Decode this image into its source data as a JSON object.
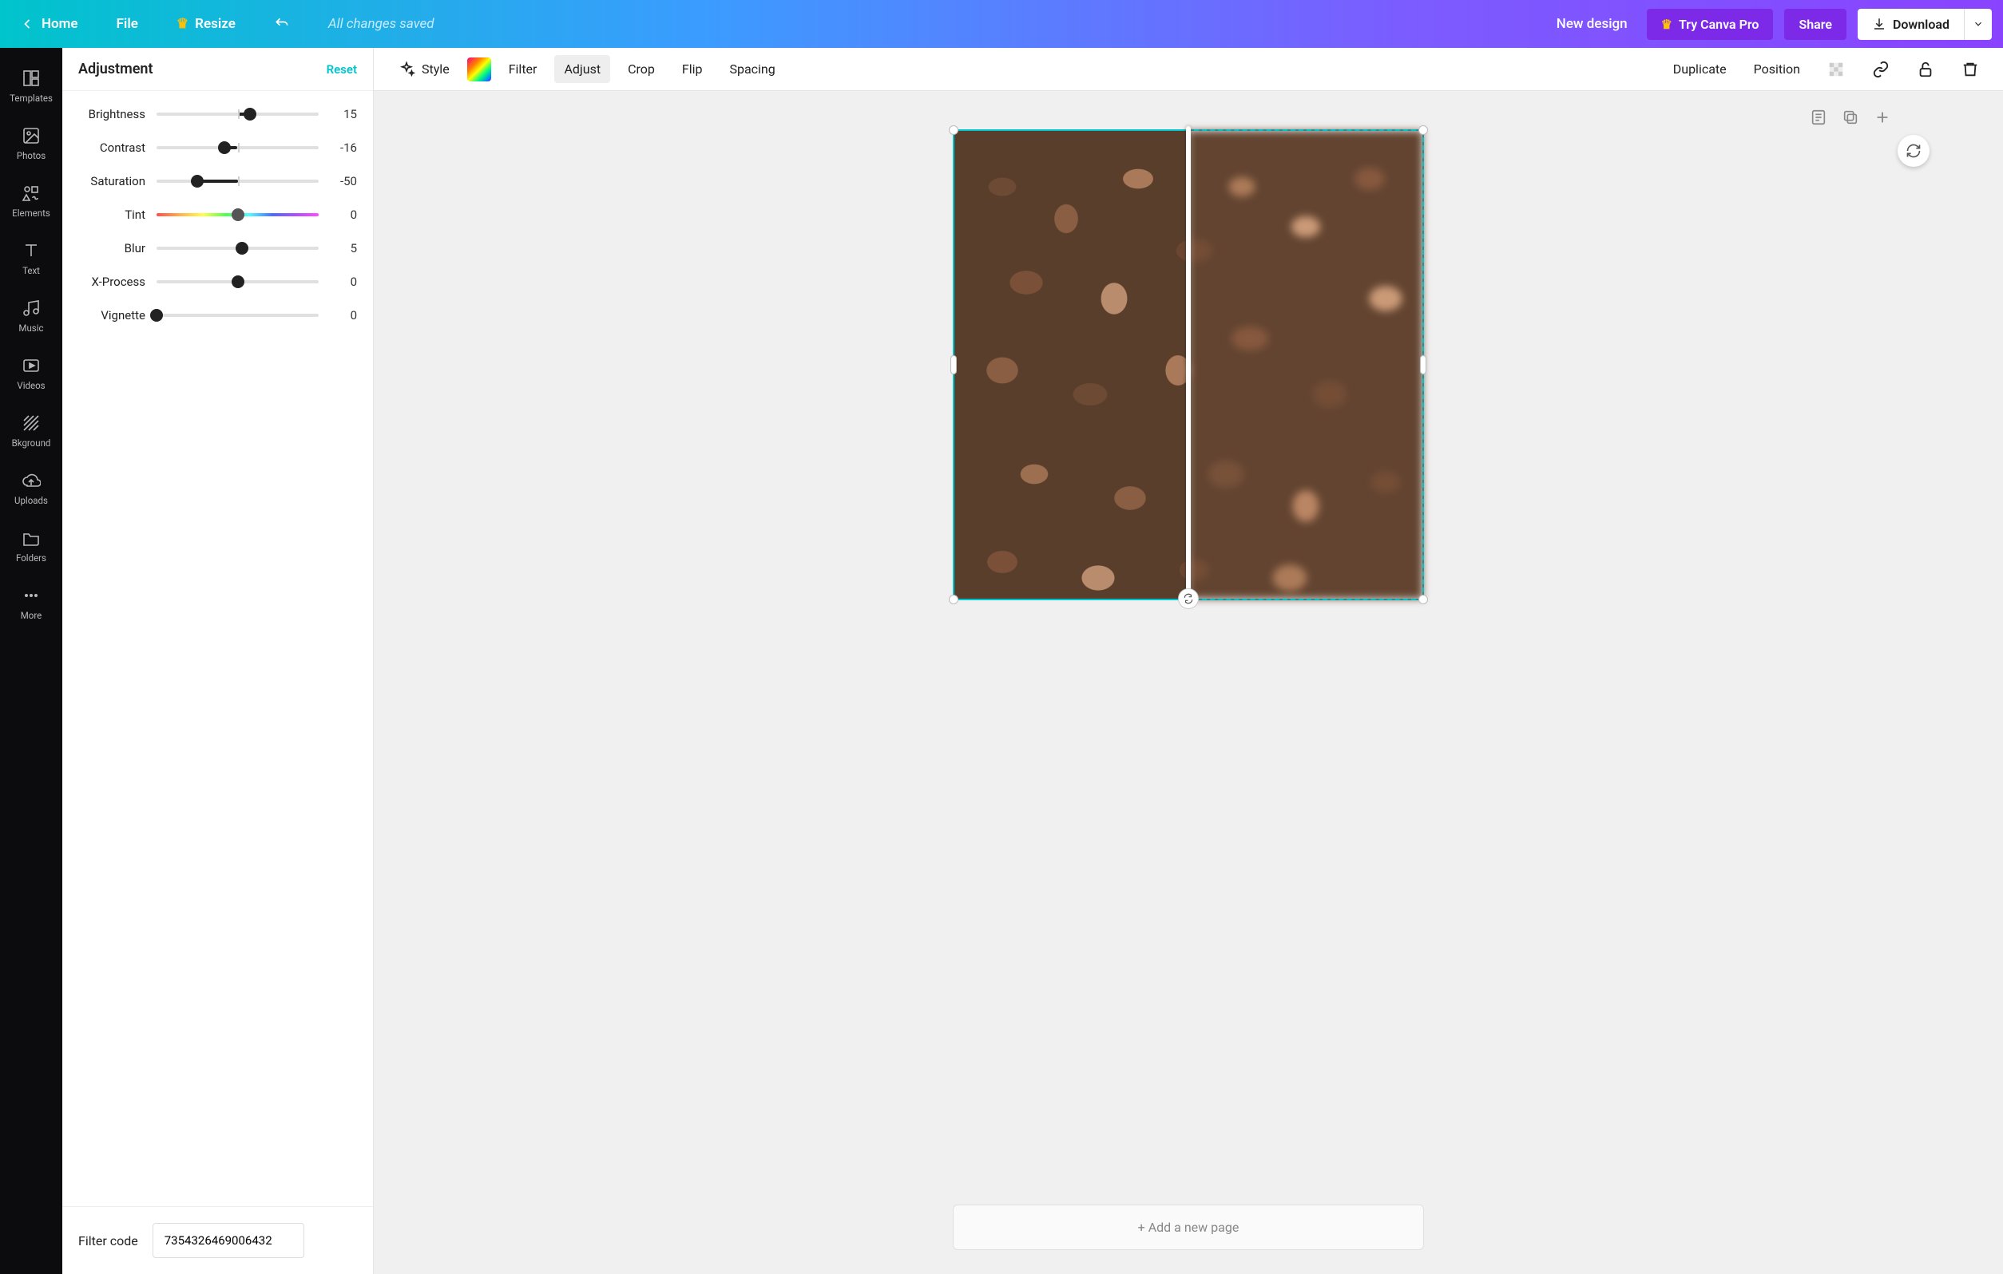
{
  "topbar": {
    "home": "Home",
    "file": "File",
    "resize": "Resize",
    "saved": "All changes saved",
    "new_design": "New design",
    "try_pro": "Try Canva Pro",
    "share": "Share",
    "download": "Download"
  },
  "rail": {
    "templates": "Templates",
    "photos": "Photos",
    "elements": "Elements",
    "text": "Text",
    "music": "Music",
    "videos": "Videos",
    "background": "Bkground",
    "uploads": "Uploads",
    "folders": "Folders",
    "more": "More"
  },
  "panel": {
    "title": "Adjustment",
    "reset": "Reset",
    "filter_code_label": "Filter code",
    "filter_code_value": "7354326469006432",
    "sliders": [
      {
        "label": "Brightness",
        "value": 15,
        "min": -100,
        "max": 100,
        "style": "plain",
        "zero_tick": true
      },
      {
        "label": "Contrast",
        "value": -16,
        "min": -100,
        "max": 100,
        "style": "plain",
        "zero_tick": true
      },
      {
        "label": "Saturation",
        "value": -50,
        "min": -100,
        "max": 100,
        "style": "plain",
        "zero_tick": true
      },
      {
        "label": "Tint",
        "value": 0,
        "min": -100,
        "max": 100,
        "style": "rainbow",
        "zero_tick": false
      },
      {
        "label": "Blur",
        "value": 5,
        "min": -100,
        "max": 100,
        "style": "plain",
        "zero_tick": true
      },
      {
        "label": "X-Process",
        "value": 0,
        "min": -100,
        "max": 100,
        "style": "plain",
        "zero_tick": false
      },
      {
        "label": "Vignette",
        "value": 0,
        "min": 0,
        "max": 100,
        "style": "plain",
        "zero_tick": false
      }
    ]
  },
  "context": {
    "style": "Style",
    "filter": "Filter",
    "adjust": "Adjust",
    "crop": "Crop",
    "flip": "Flip",
    "spacing": "Spacing",
    "duplicate": "Duplicate",
    "position": "Position"
  },
  "canvas": {
    "add_page": "+ Add a new page"
  }
}
